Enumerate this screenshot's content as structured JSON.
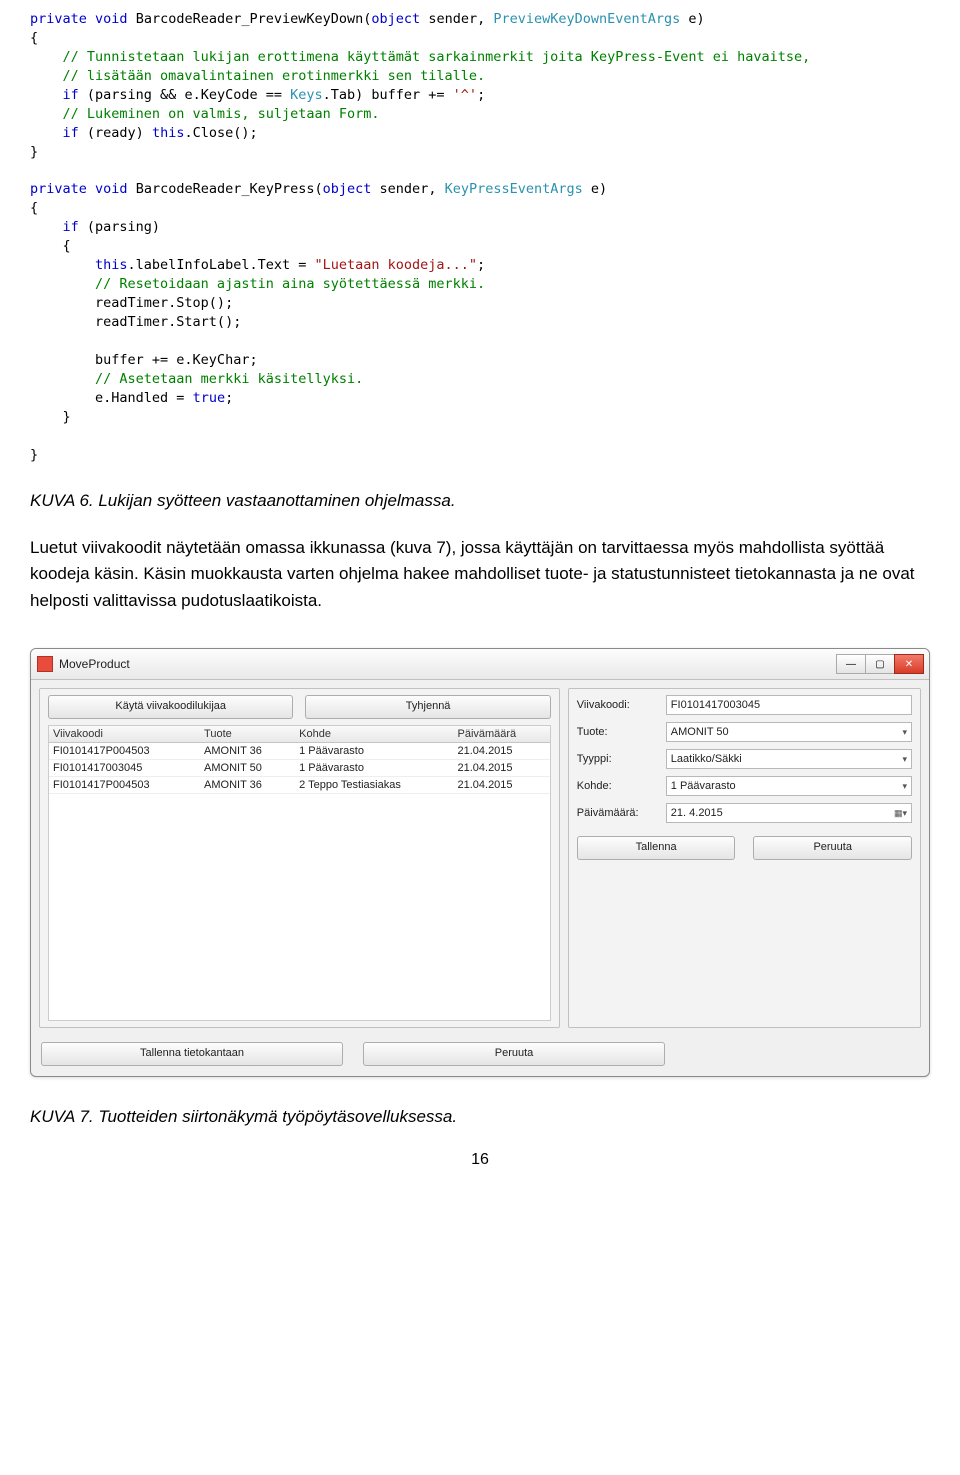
{
  "code1": {
    "l1_kw1": "private",
    "l1_kw2": "void",
    "l1_name": " BarcodeReader_PreviewKeyDown(",
    "l1_kw3": "object",
    "l1_arg": " sender, ",
    "l1_typ": "PreviewKeyDownEventArgs",
    "l1_end": " e)",
    "l2": "{",
    "l3": "    // Tunnistetaan lukijan erottimena käyttämät sarkainmerkit joita KeyPress-Event ei havaitse,",
    "l4": "    // lisätään omavalintainen erotinmerkki sen tilalle.",
    "l5a": "    ",
    "l5_if": "if",
    "l5b": " (parsing && e.KeyCode == ",
    "l5_typ": "Keys",
    "l5c": ".Tab) buffer += ",
    "l5_str": "'^'",
    "l5d": ";",
    "l6": "    // Lukeminen on valmis, suljetaan Form.",
    "l7a": "    ",
    "l7_if": "if",
    "l7b": " (ready) ",
    "l7_this": "this",
    "l7c": ".Close();",
    "l8": "}"
  },
  "code2": {
    "l1_kw1": "private",
    "l1_kw2": "void",
    "l1_name": " BarcodeReader_KeyPress(",
    "l1_kw3": "object",
    "l1_arg": " sender, ",
    "l1_typ": "KeyPressEventArgs",
    "l1_end": " e)",
    "l2": "{",
    "l3a": "    ",
    "l3_if": "if",
    "l3b": " (parsing)",
    "l4": "    {",
    "l5a": "        ",
    "l5_this": "this",
    "l5b": ".labelInfoLabel.Text = ",
    "l5_str": "\"Luetaan koodeja...\"",
    "l5c": ";",
    "l6": "        // Resetoidaan ajastin aina syötettäessä merkki.",
    "l7": "        readTimer.Stop();",
    "l8": "        readTimer.Start();",
    "l9": "",
    "l10": "        buffer += e.KeyChar;",
    "l11": "        // Asetetaan merkki käsitellyksi.",
    "l12a": "        e.Handled = ",
    "l12_true": "true",
    "l12b": ";",
    "l13": "    }",
    "l14": "",
    "l15": "}"
  },
  "caption1": "KUVA 6. Lukijan syötteen vastaanottaminen ohjelmassa.",
  "para": "Luetut viivakoodit näytetään omassa ikkunassa (kuva 7), jossa käyttäjän on tarvittaessa myös mahdollista syöttää koodeja käsin. Käsin muokkausta varten ohjelma hakee mahdolliset tuote- ja statustunnisteet tietokannasta ja ne ovat helposti valittavissa pudotuslaatikoista.",
  "dialog": {
    "title": "MoveProduct",
    "btn_use": "Käytä viivakoodilukijaa",
    "btn_clear": "Tyhjennä",
    "grid_headers": [
      "Viivakoodi",
      "Tuote",
      "Kohde",
      "Päivämäärä"
    ],
    "rows": [
      [
        "FI0101417P004503",
        "AMONIT 36",
        "1 Päävarasto",
        "21.04.2015"
      ],
      [
        "FI0101417003045",
        "AMONIT 50",
        "1 Päävarasto",
        "21.04.2015"
      ],
      [
        "FI0101417P004503",
        "AMONIT 36",
        "2 Teppo Testiasiakas",
        "21.04.2015"
      ]
    ],
    "form": {
      "f_viivakoodi_label": "Viivakoodi:",
      "f_viivakoodi": "FI0101417003045",
      "f_tuote_label": "Tuote:",
      "f_tuote": "AMONIT 50",
      "f_tyyppi_label": "Tyyppi:",
      "f_tyyppi": "Laatikko/Säkki",
      "f_kohde_label": "Kohde:",
      "f_kohde": "1 Päävarasto",
      "f_pvm_label": "Päivämäärä:",
      "f_pvm": "21. 4.2015"
    },
    "btn_save": "Tallenna",
    "btn_cancel": "Peruuta",
    "btn_save_db": "Tallenna tietokantaan",
    "btn_cancel2": "Peruuta"
  },
  "caption2": "KUVA 7. Tuotteiden siirtonäkymä työpöytäsovelluksessa.",
  "pagenum": "16"
}
